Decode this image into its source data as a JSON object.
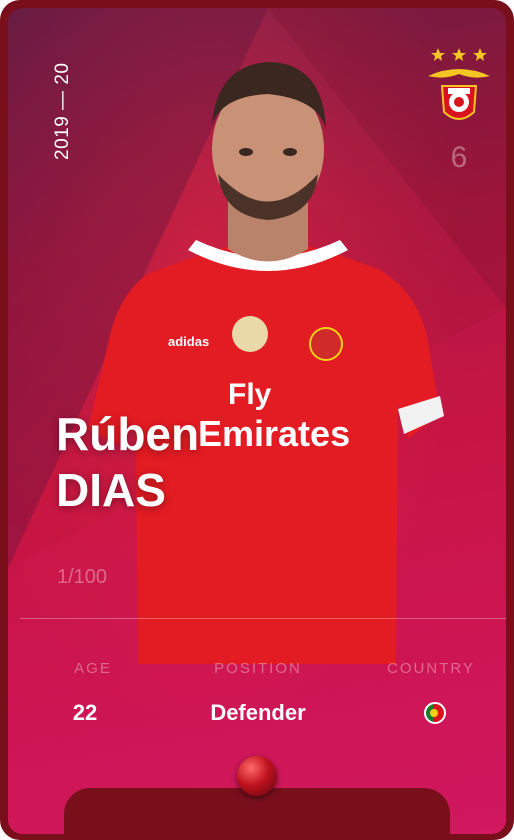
{
  "card": {
    "season": "2019 — 20",
    "shirt_number": "6",
    "player_first_name": "Rúben",
    "player_last_name": "DIAS",
    "serial": "1/100",
    "club_logo_icon": "sl-benfica-crest-icon",
    "rarity_icon": "rare-gem-icon",
    "colors": {
      "primary": "#c31440",
      "frame": "#7a0f1c",
      "shirt_red": "#e31b23"
    }
  },
  "stats": {
    "age_label": "AGE",
    "age_value": "22",
    "position_label": "POSITION",
    "position_value": "Defender",
    "country_label": "COUNTRY",
    "country_flag_icon": "portugal-flag-icon"
  }
}
